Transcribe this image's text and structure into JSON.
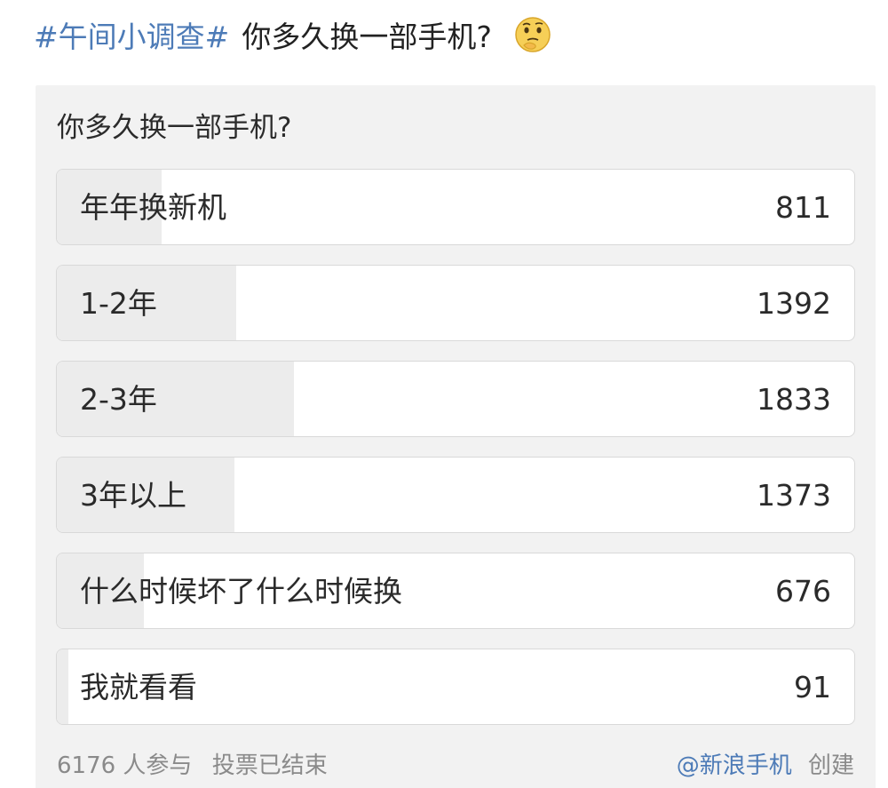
{
  "post": {
    "hashtag": "#午间小调查#",
    "title": "你多久换一部手机?",
    "emoji": "thinking-face-icon"
  },
  "poll": {
    "question": "你多久换一部手机?",
    "options": [
      {
        "label": "年年换新机",
        "count": "811",
        "votes": 811
      },
      {
        "label": "1-2年",
        "count": "1392",
        "votes": 1392
      },
      {
        "label": "2-3年",
        "count": "1833",
        "votes": 1833
      },
      {
        "label": "3年以上",
        "count": "1373",
        "votes": 1373
      },
      {
        "label": "什么时候坏了什么时候换",
        "count": "676",
        "votes": 676
      },
      {
        "label": "我就看看",
        "count": "91",
        "votes": 91
      }
    ],
    "participants": "6176 人参与",
    "status": "投票已结束",
    "creator": "@新浪手机",
    "created_label": "创建"
  },
  "colors": {
    "link": "#4d7bb7",
    "fill": "#ececec",
    "card": "#f2f2f2"
  }
}
